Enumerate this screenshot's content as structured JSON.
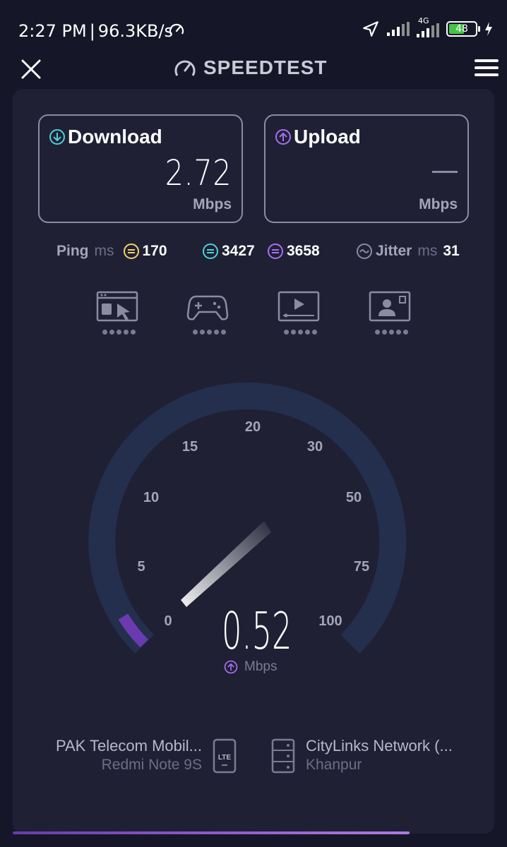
{
  "status_bar": {
    "time": "2:27 PM",
    "separator": "|",
    "data_speed": "96.3KB/s",
    "network_type": "4G",
    "battery_level": "48"
  },
  "header": {
    "title": "SPEEDTEST"
  },
  "download": {
    "label": "Download",
    "value": "2.72",
    "unit": "Mbps"
  },
  "upload": {
    "label": "Upload",
    "value": "—",
    "unit": "Mbps"
  },
  "metrics": {
    "ping_label": "Ping",
    "ping_unit": "ms",
    "ping_idle": "170",
    "ping_download": "3427",
    "ping_upload": "3658",
    "jitter_label": "Jitter",
    "jitter_unit": "ms",
    "jitter_value": "31"
  },
  "activities": [
    "web-browsing-icon",
    "gaming-icon",
    "video-streaming-icon",
    "video-call-icon"
  ],
  "gauge": {
    "scale_labels": [
      "0",
      "5",
      "10",
      "15",
      "20",
      "30",
      "50",
      "75",
      "100"
    ],
    "current_value": "0.52",
    "unit": "Mbps",
    "progress_fraction": 0.05
  },
  "provider": {
    "name": "PAK Telecom Mobil...",
    "device": "Redmi Note 9S",
    "badge": "LTE"
  },
  "server": {
    "name": "CityLinks Network (...",
    "location": "Khanpur"
  },
  "colors": {
    "background": "#151627",
    "panel": "#1f2034",
    "download_accent": "#4fd0d8",
    "upload_accent": "#a76ff2",
    "ping_idle_accent": "#f3d36a",
    "gauge_track": "#232f4c",
    "gauge_progress": "#6a3ab0"
  }
}
